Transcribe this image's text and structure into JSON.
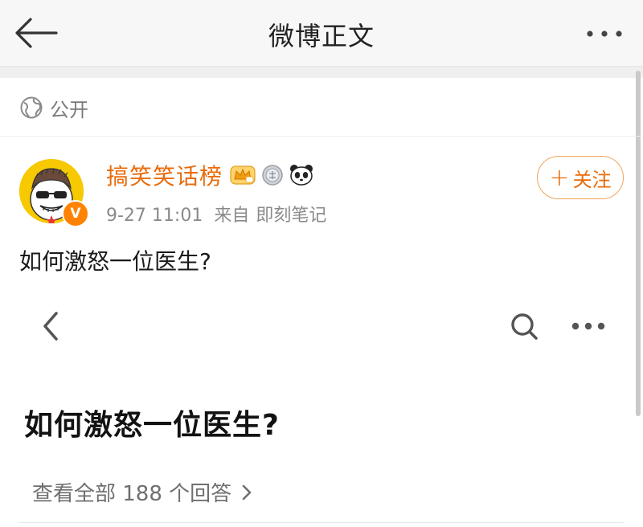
{
  "nav": {
    "title": "微博正文",
    "back_icon": "arrow-left-icon",
    "more_icon": "more-horizontal-icon"
  },
  "post": {
    "visibility": {
      "icon": "globe-icon",
      "label": "公开"
    },
    "author": {
      "name": "搞笑笑话榜",
      "verified_badge": "V",
      "badge_icons": [
        "crown-member-icon",
        "medal-icon",
        "panda-icon"
      ]
    },
    "meta": {
      "time": "9-27 11:01",
      "source_prefix": "来自",
      "source": "即刻笔记"
    },
    "follow_label": "关注",
    "text": "如何激怒一位医生?"
  },
  "embedded": {
    "back_icon": "chevron-left-icon",
    "search_icon": "search-icon",
    "more_icon": "more-horizontal-icon",
    "question_title": "如何激怒一位医生?",
    "answers_link": "查看全部 188 个回答"
  },
  "colors": {
    "accent": "#e86b0a",
    "nav_bg": "#f7f7f7",
    "badge_orange": "#ff8200",
    "avatar_yellow": "#f6c900"
  }
}
